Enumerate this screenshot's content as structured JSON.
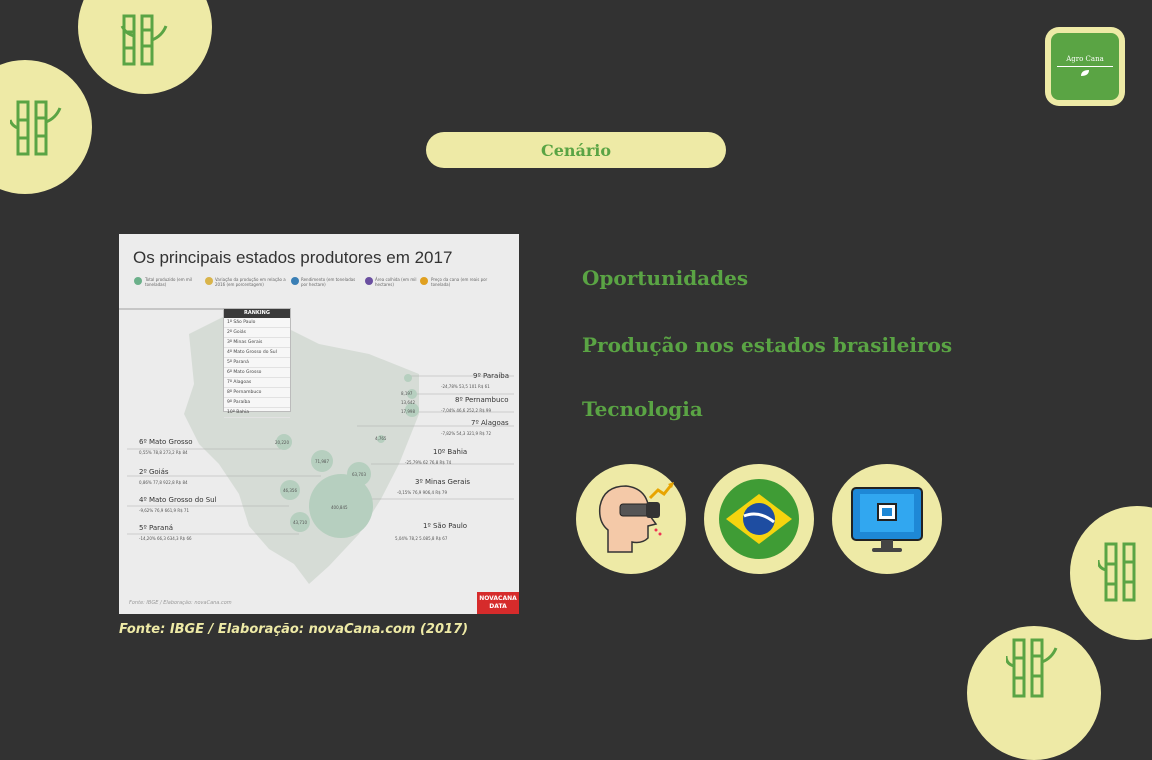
{
  "header": {
    "pill_label": "Cenário"
  },
  "logo": {
    "text": "Agro Cana"
  },
  "infographic": {
    "title": "Os principais estados produtores em 2017",
    "legend": [
      {
        "label": "Total produzido (em mil toneladas)",
        "color": "#6bb08a"
      },
      {
        "label": "Variação da produção em relação a 2016 (em porcentagem)",
        "color": "#d9b44a"
      },
      {
        "label": "Rendimento (em toneladas por hectare)",
        "color": "#3a7fb5"
      },
      {
        "label": "Área colhida (em mil hectares)",
        "color": "#6a4fa0"
      },
      {
        "label": "Preço da cana (em reais por tonelada)",
        "color": "#e0a020"
      }
    ],
    "ranking": {
      "title": "RANKING",
      "rows": [
        "1º São Paulo",
        "2º Goiás",
        "3º Minas Gerais",
        "4º Mato Grosso do Sul",
        "5º Paraná",
        "6º Mato Grosso",
        "7º Alagoas",
        "8º Pernambuco",
        "9º Paraíba",
        "10º Bahia"
      ]
    },
    "states": [
      {
        "label": "9º Paraíba",
        "stats": "-24,78%  53,5  101  R$ 61"
      },
      {
        "label": "8º Pernambuco",
        "stats": "-7,04%  46,6  252,2  R$ 99"
      },
      {
        "label": "7º Alagoas",
        "stats": "-7,82%  54,3  321,9  R$ 72"
      },
      {
        "label": "10º Bahia",
        "stats": "-25,79%  62  76,8  R$ 74"
      },
      {
        "label": "3º Minas Gerais",
        "stats": "-0,15%  76,9  906,4  R$ 79"
      },
      {
        "label": "1º São Paulo",
        "stats": "5,04%  78,2  5.085,8  R$ 67"
      },
      {
        "label": "6º Mato Grosso",
        "stats": "0,55%  78,8  273,2  R$ 84"
      },
      {
        "label": "2º Goiás",
        "stats": "0,86%  77,8  922,8  R$ 84"
      },
      {
        "label": "4º Mato Grosso do Sul",
        "stats": "-9,62%  76,9  661,9  R$ 71"
      },
      {
        "label": "5º Paraná",
        "stats": "-14,20%  66,3  634,3  R$ 66"
      }
    ],
    "bubbles": [
      "8,197",
      "13,642",
      "17,998",
      "4,765",
      "20,220",
      "71,987",
      "63,703",
      "46,356",
      "43,710",
      "400,845"
    ],
    "footer": "Fonte: IBGE / Elaboração: novaCana.com",
    "brand_line1": "NOVACANA",
    "brand_line2": "DATA"
  },
  "source_caption": "Fonte: IBGE / Elaboração: novaCana.com (2017)",
  "menu": {
    "items": [
      "Oportunidades",
      "Produção nos estados brasileiros",
      "Tecnologia"
    ]
  },
  "icons": [
    "binoculars-head-icon",
    "brazil-flag-icon",
    "computer-monitor-icon"
  ],
  "colors": {
    "background": "#323232",
    "accent_green": "#5aa444",
    "cream": "#eeeaa6"
  }
}
